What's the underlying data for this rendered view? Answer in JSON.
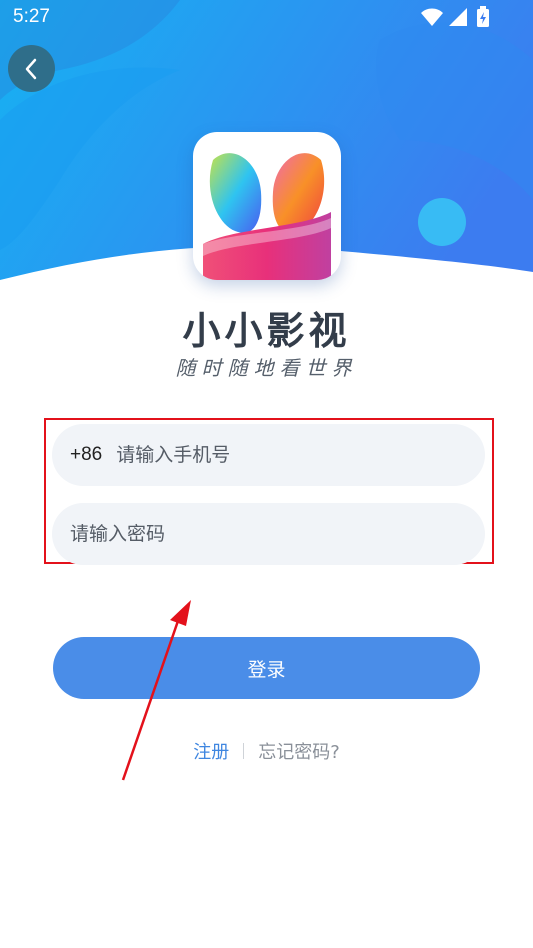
{
  "status_bar": {
    "time": "5:27",
    "icons": [
      "wifi-icon",
      "signal-icon",
      "battery-icon"
    ]
  },
  "header": {
    "back_icon": "chevron-left-icon",
    "gradient_colors": [
      "#1aa8f0",
      "#3b7ff0"
    ]
  },
  "app": {
    "name": "小小影视",
    "slogan": "随时随地看世界"
  },
  "form": {
    "country_code": "+86",
    "phone_placeholder": "请输入手机号",
    "password_placeholder": "请输入密码",
    "login_label": "登录",
    "register_label": "注册",
    "forgot_label": "忘记密码?"
  },
  "annotation": {
    "box_color": "#e3111b",
    "arrow_color": "#e3111b"
  }
}
